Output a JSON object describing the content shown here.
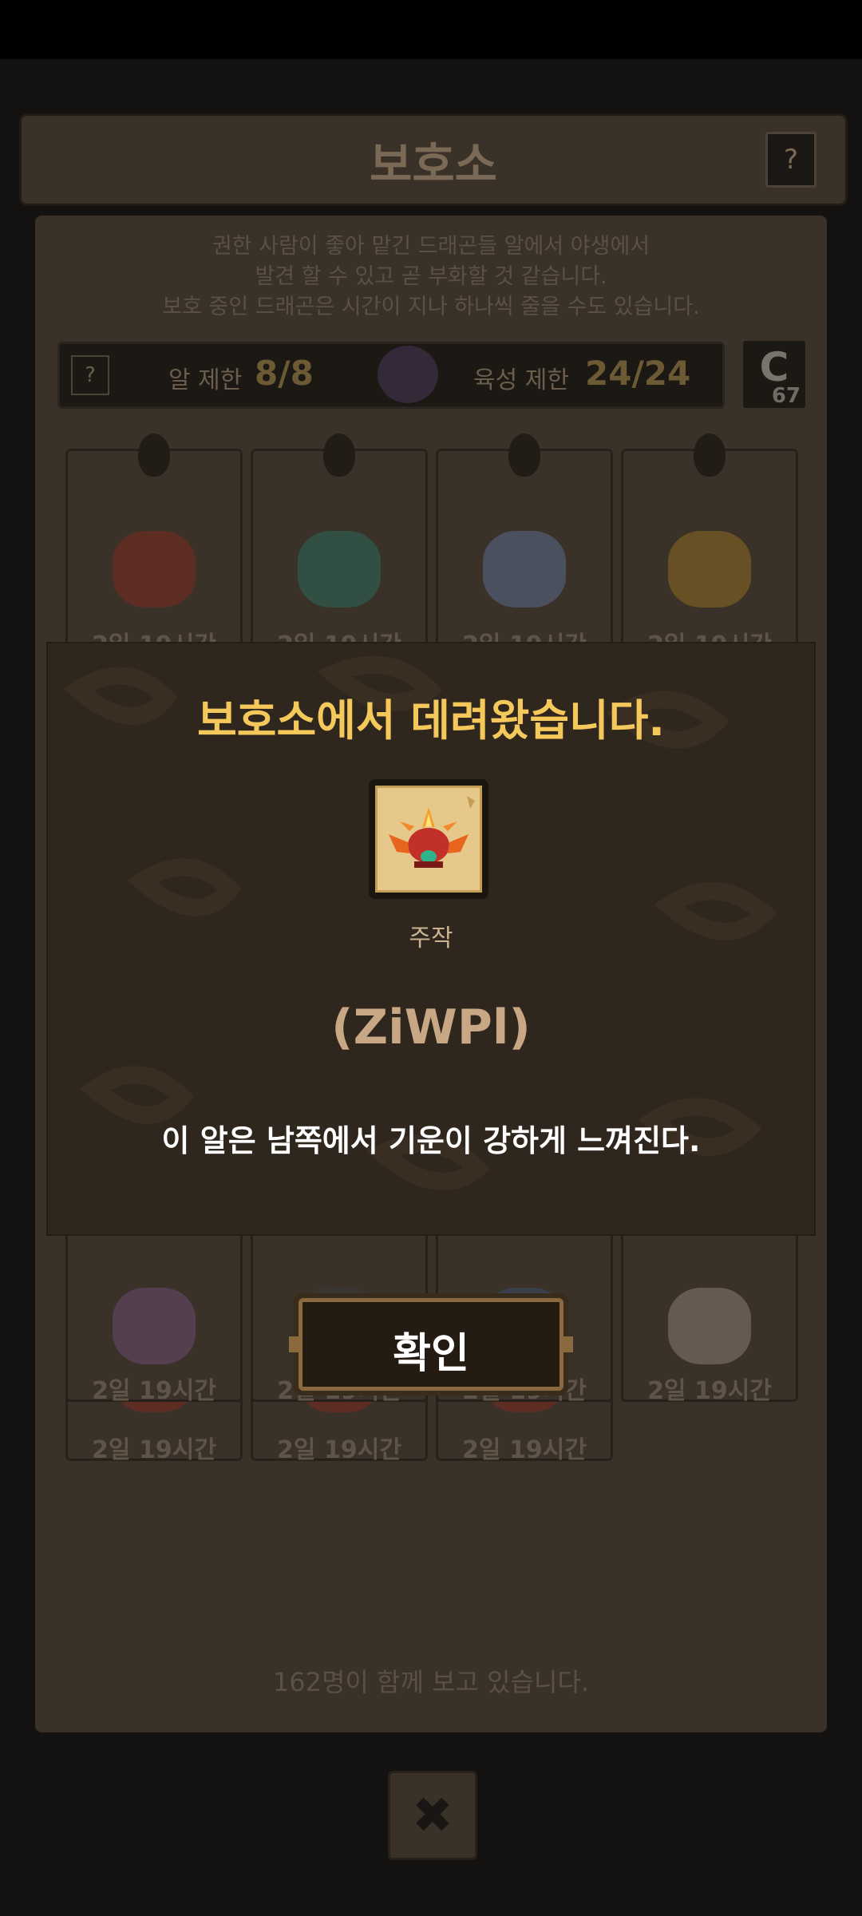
{
  "header": {
    "title": "보호소",
    "help_label": "?"
  },
  "notice": {
    "line1": "권한 사람이 좋아 맡긴 드래곤들 알에서 야생에서",
    "line2": "발견 할 수 있고 곧 부화할 것 같습니다.",
    "line3": "보호 중인 드래곤은 시간이 지나 하나씩 줄을 수도 있습니다."
  },
  "stats": {
    "help_label": "?",
    "egg_limit_label": "알 제한",
    "egg_limit_value": "8/8",
    "growth_limit_label": "육성 제한",
    "growth_limit_value": "24/24"
  },
  "coin": {
    "letter": "C",
    "count": "67"
  },
  "eggs": [
    {
      "timer": "2일 19시간",
      "color": "#7a2a20"
    },
    {
      "timer": "2일 19시간",
      "color": "#2a6a5a"
    },
    {
      "timer": "2일 19시간",
      "color": "#5a6a8a"
    },
    {
      "timer": "2일 19시간",
      "color": "#8a6a20"
    },
    {
      "timer": "2일 19시간",
      "color": "#6a4a70"
    },
    {
      "timer": "2일 19시간",
      "color": "#3a3a3a"
    },
    {
      "timer": "2일 19시간",
      "color": "#3a4a6a"
    },
    {
      "timer": "2일 19시간",
      "color": "#8a7a70"
    },
    {
      "timer": "2일 19시간",
      "color": "#7a2a20"
    },
    {
      "timer": "2일 19시간",
      "color": "#7a2a20"
    },
    {
      "timer": "2일 19시간",
      "color": "#7a2a20"
    }
  ],
  "watchers_text": "162명이 함께 보고 있습니다.",
  "close_label": "✖",
  "modal": {
    "title": "보호소에서 데려왔습니다.",
    "item_name": "주작",
    "item_code": "(ZiWPl)",
    "description": "이 알은 남쪽에서 기운이 강하게 느껴진다.",
    "confirm_label": "확인"
  },
  "colors": {
    "title_gold": "#f4c85a",
    "modal_bg": "#2f261d",
    "code_tan": "#c7a784"
  }
}
